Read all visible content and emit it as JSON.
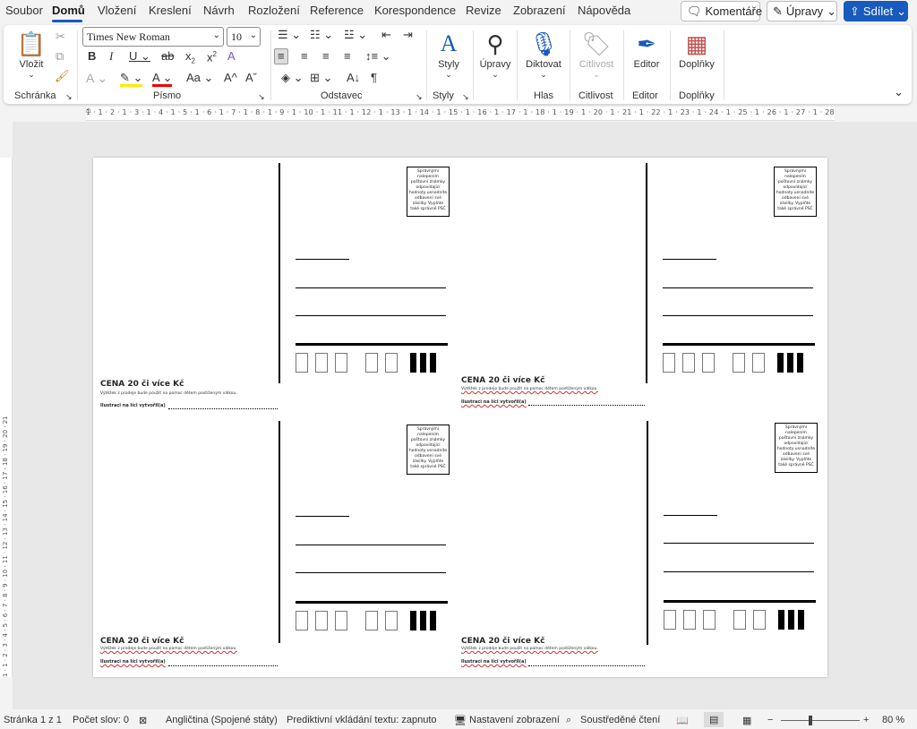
{
  "menu": {
    "tabs": [
      "Soubor",
      "Domů",
      "Vložení",
      "Kreslení",
      "Návrh",
      "Rozložení",
      "Reference",
      "Korespondence",
      "Revize",
      "Zobrazení",
      "Nápověda"
    ],
    "comments_label": "Komentáře",
    "edits_label": "Úpravy",
    "share_label": "Sdílet"
  },
  "ribbon": {
    "paste_label": "Vložit",
    "font_name": "Times New Roman",
    "font_size": "10",
    "styles_label": "Styly",
    "edit_label": "Úpravy",
    "dictate_label": "Diktovat",
    "sensitivity_label": "Citlivost",
    "editor_label": "Editor",
    "addins_label": "Doplňky",
    "groups": {
      "clipboard": "Schránka",
      "font": "Písmo",
      "paragraph": "Odstavec",
      "styles": "Styly",
      "voice": "Hlas",
      "sensitivity": "Citlivost",
      "editor": "Editor",
      "addins": "Doplňky"
    }
  },
  "ruler": {
    "text": "1 · 1 · 2 · 1 · 3 · 1 · 4 · 1 · 5 · 1 · 6 · 1 · 7 · 1 · 8 · 1 · 9 · 1 · 10 · 1 · 11 · 1 · 12 · 1 · 13 · 1 · 14 · 1 · 15 · 1 · 16 · 1 · 17 · 1 · 18 · 1 · 19 · 1 · 20 · 1 · 21 · 1 · 22 · 1 · 23 · 1 · 24 · 1 · 25 · 1 · 26 · 1 · 27 · 1 · 28 · 1 · 29 ·",
    "vtext": "1 · 1 · 2 · 3 · 4 · 5 · 6 · 7 · 8 · 9 · 10 · 11 · 12 · 13 · 14 · 15 · 16 · 17 · 18 · 19 · 20 · 21"
  },
  "document": {
    "price_text": "CENA 20 či více Kč",
    "note_text": "Výtěžek z prodeje bude použit na pomoc dětem postiženým válkou.",
    "illustration_text": "Ilustraci na líci vytvořil(a)",
    "stamp_text": "Správnými nalepením poštovní známky odpovídající hodnoty usnadníte odbavení své zásilky. Vyplňte také správné PSČ"
  },
  "status": {
    "page": "Stránka 1 z 1",
    "words": "Počet slov: 0",
    "language": "Angličtina (Spojené státy)",
    "predictive": "Prediktivní vkládání textu: zapnuto",
    "display_settings": "Nastavení zobrazení",
    "focus": "Soustředěné čtení",
    "zoom": "80 %"
  }
}
